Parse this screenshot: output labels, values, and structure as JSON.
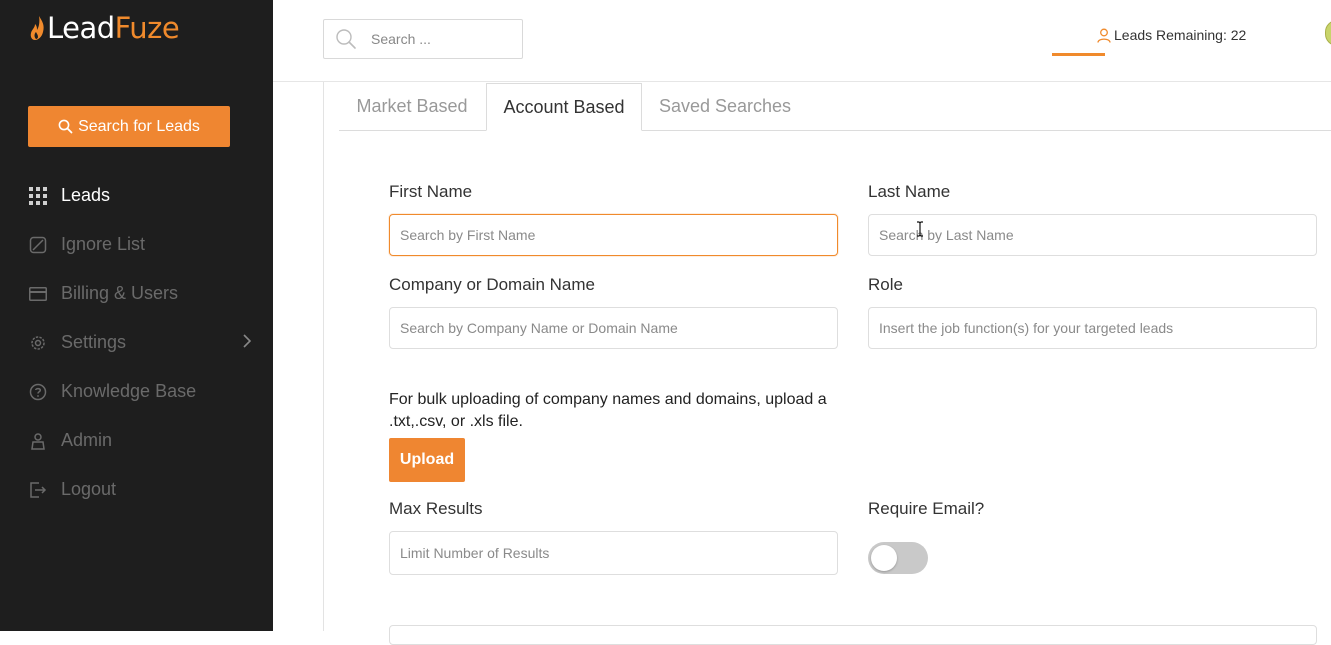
{
  "app": {
    "logo_lead": "Lead",
    "logo_fuze": "Fuze",
    "brand_color": "#ef8631"
  },
  "sidebar": {
    "search_button_label": "Search for Leads",
    "items": [
      {
        "label": "Leads",
        "icon": "grid-icon",
        "active": true
      },
      {
        "label": "Ignore List",
        "icon": "ignore-icon",
        "active": false
      },
      {
        "label": "Billing & Users",
        "icon": "credit-card-icon",
        "active": false
      },
      {
        "label": "Settings",
        "icon": "gear-icon",
        "active": false
      },
      {
        "label": "Knowledge Base",
        "icon": "help-circle-icon",
        "active": false
      },
      {
        "label": "Admin",
        "icon": "admin-icon",
        "active": false
      },
      {
        "label": "Logout",
        "icon": "logout-icon",
        "active": false
      }
    ]
  },
  "header": {
    "search_placeholder": "Search ...",
    "leads_remaining": "Leads Remaining: 22"
  },
  "tabs": [
    {
      "label": "Market Based",
      "active": false
    },
    {
      "label": "Account Based",
      "active": true
    },
    {
      "label": "Saved Searches",
      "active": false
    }
  ],
  "form": {
    "first_name": {
      "label": "First Name",
      "placeholder": "Search by First Name",
      "value": ""
    },
    "last_name": {
      "label": "Last Name",
      "placeholder": "Search by Last Name",
      "value": ""
    },
    "company": {
      "label": "Company or Domain Name",
      "placeholder": "Search by Company Name or Domain Name",
      "value": ""
    },
    "role": {
      "label": "Role",
      "placeholder": "Insert the job function(s) for your targeted leads",
      "value": ""
    },
    "bulk_text": "For bulk uploading of company names and domains, upload a .txt,.csv, or .xls file.",
    "upload_label": "Upload",
    "max_results": {
      "label": "Max Results",
      "placeholder": "Limit Number of Results",
      "value": ""
    },
    "require_email": {
      "label": "Require Email?",
      "on": false
    }
  }
}
